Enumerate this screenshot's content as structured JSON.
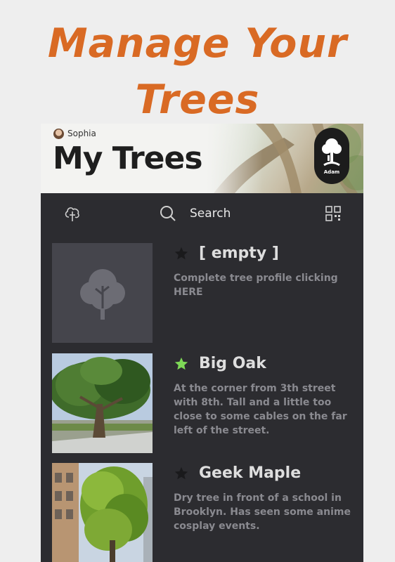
{
  "promo": {
    "line1": "Manage Your",
    "line2": "Trees"
  },
  "header": {
    "user_name": "Sophia",
    "title": "My Trees",
    "logo_text": "Adam"
  },
  "toolbar": {
    "add_tree_icon": "tree-add-icon",
    "search_icon": "search-icon",
    "search_label": "Search",
    "qr_icon": "qr-code-icon"
  },
  "colors": {
    "promo": "#d96a24",
    "panel": "#2c2c30",
    "star_active": "#7ed957",
    "star_inactive": "#1a1a1c",
    "muted_text": "#8a8a90"
  },
  "trees": [
    {
      "name": "[ empty ]",
      "starred": false,
      "description": "Complete tree profile clicking HERE",
      "image": "placeholder-tree-icon"
    },
    {
      "name": "Big Oak",
      "starred": true,
      "description": "At the corner from 3th street with 8th. Tall and a little too close to some cables on the far left of the street.",
      "image": "oak-photo"
    },
    {
      "name": "Geek Maple",
      "starred": false,
      "description": "Dry tree in front of a school in Brooklyn. Has seen some anime cosplay events.",
      "image": "maple-photo"
    }
  ]
}
